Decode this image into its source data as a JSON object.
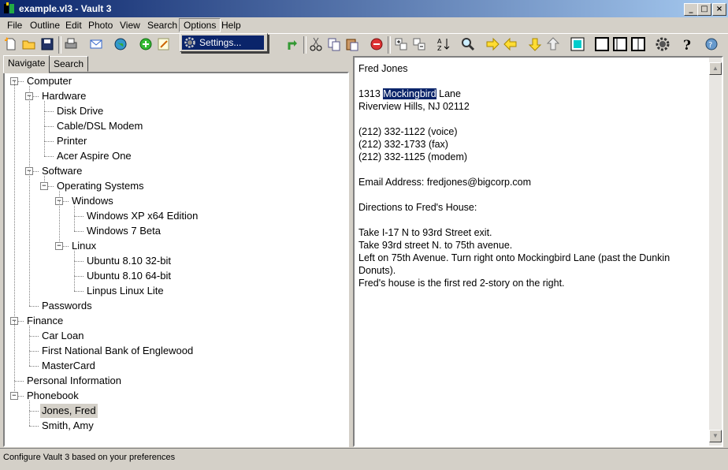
{
  "window": {
    "title": "example.vl3 - Vault 3",
    "min": "_",
    "max": "□",
    "close": "×"
  },
  "menu": [
    "File",
    "Outline",
    "Edit",
    "Photo",
    "View",
    "Search",
    "Options",
    "Help"
  ],
  "options_menu": {
    "settings_label": "Settings..."
  },
  "tabs": {
    "navigate": "Navigate",
    "search": "Search"
  },
  "tree": [
    {
      "label": "Computer",
      "depth": 0,
      "expanded": true
    },
    {
      "label": "Hardware",
      "depth": 1,
      "expanded": true
    },
    {
      "label": "Disk Drive",
      "depth": 2
    },
    {
      "label": "Cable/DSL Modem",
      "depth": 2
    },
    {
      "label": "Printer",
      "depth": 2
    },
    {
      "label": "Acer Aspire One",
      "depth": 2
    },
    {
      "label": "Software",
      "depth": 1,
      "expanded": true
    },
    {
      "label": "Operating Systems",
      "depth": 2,
      "expanded": true
    },
    {
      "label": "Windows",
      "depth": 3,
      "expanded": true
    },
    {
      "label": "Windows XP x64 Edition",
      "depth": 4
    },
    {
      "label": "Windows 7 Beta",
      "depth": 4
    },
    {
      "label": "Linux",
      "depth": 3,
      "expanded": true
    },
    {
      "label": "Ubuntu 8.10 32-bit",
      "depth": 4
    },
    {
      "label": "Ubuntu 8.10 64-bit",
      "depth": 4
    },
    {
      "label": "Linpus Linux Lite",
      "depth": 4
    },
    {
      "label": "Passwords",
      "depth": 1
    },
    {
      "label": "Finance",
      "depth": 0,
      "expanded": true
    },
    {
      "label": "Car Loan",
      "depth": 1
    },
    {
      "label": "First National Bank of Englewood",
      "depth": 1
    },
    {
      "label": "MasterCard",
      "depth": 1
    },
    {
      "label": "Personal Information",
      "depth": 0
    },
    {
      "label": "Phonebook",
      "depth": 0,
      "expanded": true
    },
    {
      "label": "Jones, Fred",
      "depth": 1,
      "selected": true
    },
    {
      "label": "Smith, Amy",
      "depth": 1
    }
  ],
  "note": {
    "name": "Fred Jones",
    "addr_pre": "1313 ",
    "addr_hl": "Mockingbird",
    "addr_post": " Lane",
    "city": "Riverview Hills, NJ  02112",
    "phone_voice": "(212) 332-1122 (voice)",
    "phone_fax": "(212) 332-1733 (fax)",
    "phone_modem": "(212) 332-1125 (modem)",
    "email": "Email Address:  fredjones@bigcorp.com",
    "directions_title": "Directions to Fred's House:",
    "dir1": "Take I-17 N to 93rd Street exit.",
    "dir2": "Take 93rd street N. to 75th avenue.",
    "dir3": "Left on 75th Avenue.  Turn right onto Mockingbird Lane (past the Dunkin Donuts).",
    "dir4": "Fred's house is the first red 2-story on the right."
  },
  "status": "Configure Vault 3 based on your preferences",
  "toolbar_icons": [
    "new-icon",
    "open-icon",
    "save-icon",
    "print-icon",
    "email-icon",
    "web-icon",
    "add-icon",
    "edit-icon",
    "redo-icon",
    "cut-icon",
    "copy-icon",
    "paste-icon",
    "delete-icon",
    "expand-icon",
    "collapse-icon",
    "sort-icon",
    "find-icon",
    "move-right-icon",
    "move-left-icon",
    "move-down-icon",
    "move-up-icon",
    "highlight-icon",
    "layout1-icon",
    "layout2-icon",
    "layout3-icon",
    "settings-icon",
    "help-icon",
    "about-icon"
  ],
  "colors": {
    "accent": "#0a246a",
    "face": "#d4d0c8"
  }
}
